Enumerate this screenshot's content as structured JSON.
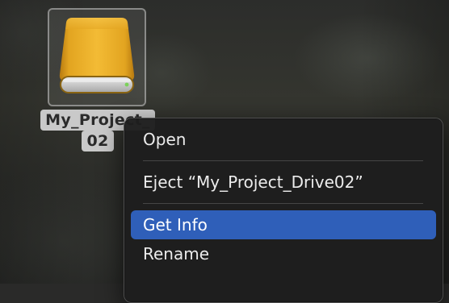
{
  "drive": {
    "label_line1": "My_Project_",
    "label_line2": "02",
    "icon": "external-drive-icon",
    "color": "#e0a21c"
  },
  "context_menu": {
    "items": [
      {
        "label": "Open"
      },
      {
        "label": "Eject “My_Project_Drive02”"
      },
      {
        "label": "Get Info",
        "highlighted": true
      },
      {
        "label": "Rename"
      }
    ],
    "highlight_color": "#2f5fb9"
  }
}
